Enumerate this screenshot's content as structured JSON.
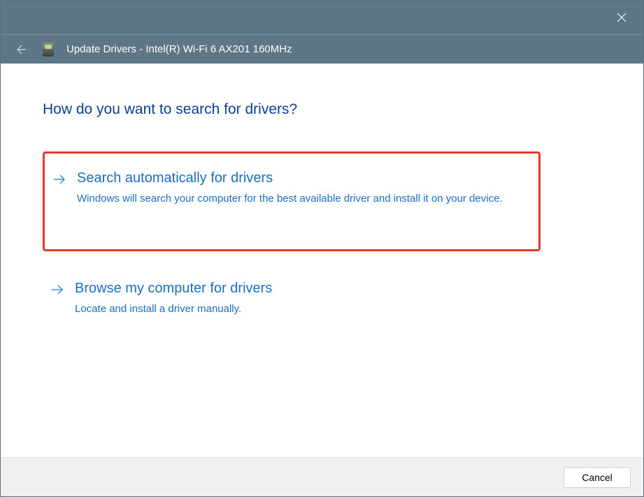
{
  "titlebar": {
    "close_label": "Close"
  },
  "header": {
    "title": "Update Drivers - Intel(R) Wi-Fi 6 AX201 160MHz"
  },
  "main": {
    "heading": "How do you want to search for drivers?",
    "options": [
      {
        "title": "Search automatically for drivers",
        "description": "Windows will search your computer for the best available driver and install it on your device.",
        "highlighted": true
      },
      {
        "title": "Browse my computer for drivers",
        "description": "Locate and install a driver manually.",
        "highlighted": false
      }
    ]
  },
  "footer": {
    "cancel_label": "Cancel"
  }
}
